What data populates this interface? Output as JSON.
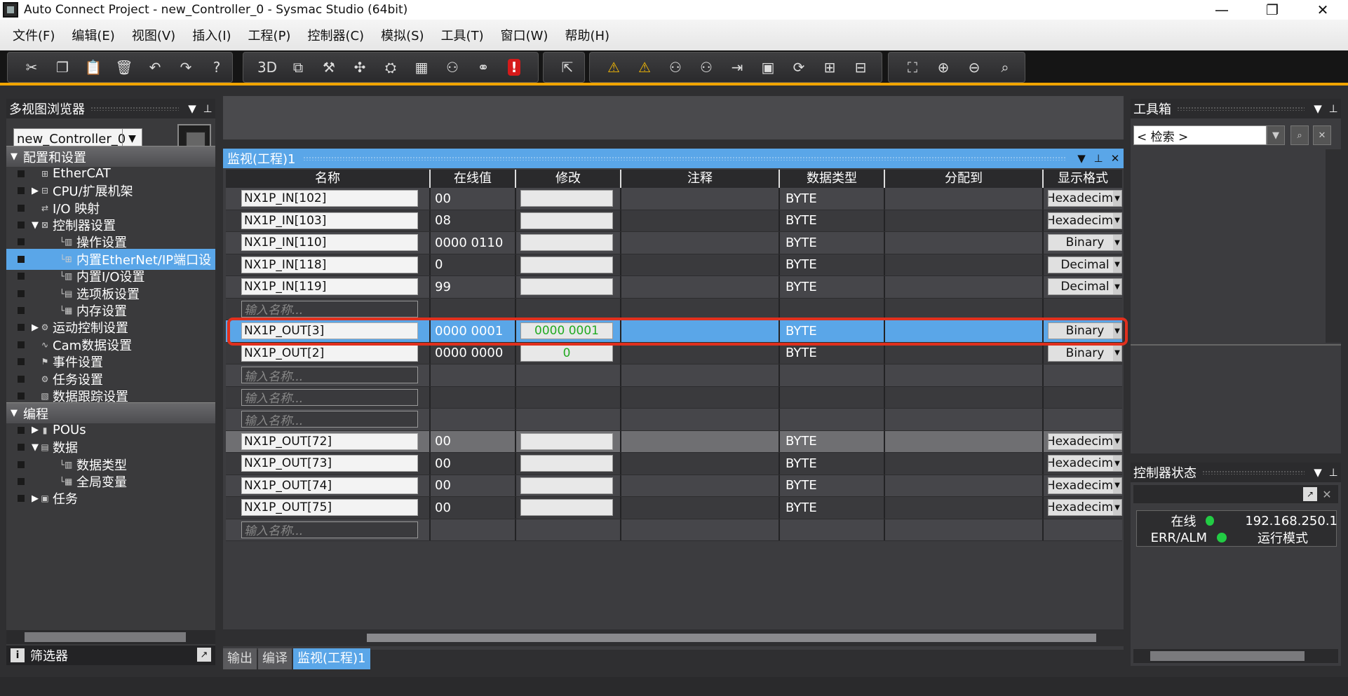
{
  "window": {
    "title": "Auto Connect Project - new_Controller_0 - Sysmac Studio (64bit)",
    "minimize": "—",
    "restore": "❐",
    "close": "✕"
  },
  "menu": [
    "文件(F)",
    "编辑(E)",
    "视图(V)",
    "插入(I)",
    "工程(P)",
    "控制器(C)",
    "模拟(S)",
    "工具(T)",
    "窗口(W)",
    "帮助(H)"
  ],
  "toolbar": {
    "group1": [
      {
        "name": "cut-icon",
        "glyph": "✂"
      },
      {
        "name": "copy-icon",
        "glyph": "❐"
      },
      {
        "name": "paste-icon",
        "glyph": "📋"
      },
      {
        "name": "delete-icon",
        "glyph": "🗑"
      },
      {
        "name": "undo-icon",
        "glyph": "↶"
      },
      {
        "name": "redo-icon",
        "glyph": "↷"
      },
      {
        "name": "help-icon",
        "glyph": "?"
      }
    ],
    "group2": [
      {
        "name": "3d-view-icon",
        "glyph": "3D"
      },
      {
        "name": "windows-icon",
        "glyph": "⧉"
      },
      {
        "name": "build-icon",
        "glyph": "⚒"
      },
      {
        "name": "tool-icon",
        "glyph": "✣"
      },
      {
        "name": "online-icon",
        "glyph": "⛭"
      },
      {
        "name": "table-icon",
        "glyph": "▦"
      },
      {
        "name": "io-icon",
        "glyph": "⚇"
      },
      {
        "name": "binoculars-icon",
        "glyph": "⚭"
      },
      {
        "name": "error-icon",
        "glyph": "!"
      }
    ],
    "group3": [
      {
        "name": "check-icon",
        "glyph": "⇱"
      }
    ],
    "group4": [
      {
        "name": "warning-icon",
        "glyph": "⚠"
      },
      {
        "name": "warning-off-icon",
        "glyph": "⚠"
      },
      {
        "name": "glasses-icon",
        "glyph": "⚇"
      },
      {
        "name": "glasses-stop-icon",
        "glyph": "⚇"
      },
      {
        "name": "step-icon",
        "glyph": "⇥"
      },
      {
        "name": "blocks-icon",
        "glyph": "▣"
      },
      {
        "name": "refresh-icon",
        "glyph": "⟳"
      },
      {
        "name": "network-icon",
        "glyph": "⊞"
      },
      {
        "name": "network2-icon",
        "glyph": "⊟"
      }
    ],
    "group5": [
      {
        "name": "fit-icon",
        "glyph": "⛶"
      },
      {
        "name": "zoom-in-icon",
        "glyph": "⊕"
      },
      {
        "name": "zoom-out-icon",
        "glyph": "⊖"
      },
      {
        "name": "zoom-reset-icon",
        "glyph": "⌕"
      }
    ]
  },
  "left_panel": {
    "title": "多视图浏览器",
    "controller": "new_Controller_0",
    "tree": [
      {
        "label": "配置和设置",
        "type": "section",
        "arrow": "▼"
      },
      {
        "label": "EtherCAT",
        "indent": 0,
        "arrow": "",
        "icon": "⊞"
      },
      {
        "label": "CPU/扩展机架",
        "indent": 0,
        "arrow": "▶",
        "icon": "⊟"
      },
      {
        "label": "I/O 映射",
        "indent": 0,
        "arrow": "",
        "icon": "⇄"
      },
      {
        "label": "控制器设置",
        "indent": 0,
        "arrow": "▼",
        "icon": "⊠"
      },
      {
        "label": "操作设置",
        "indent": 1,
        "arrow": "",
        "icon": "▥"
      },
      {
        "label": "内置EtherNet/IP端口设",
        "indent": 1,
        "arrow": "",
        "icon": "⊞",
        "selected": true
      },
      {
        "label": "内置I/O设置",
        "indent": 1,
        "arrow": "",
        "icon": "▥"
      },
      {
        "label": "选项板设置",
        "indent": 1,
        "arrow": "",
        "icon": "▤"
      },
      {
        "label": "内存设置",
        "indent": 1,
        "arrow": "",
        "icon": "▦"
      },
      {
        "label": "运动控制设置",
        "indent": 0,
        "arrow": "▶",
        "icon": "⚙"
      },
      {
        "label": "Cam数据设置",
        "indent": 0,
        "arrow": "",
        "icon": "∿"
      },
      {
        "label": "事件设置",
        "indent": 0,
        "arrow": "",
        "icon": "⚑"
      },
      {
        "label": "任务设置",
        "indent": 0,
        "arrow": "",
        "icon": "⚙"
      },
      {
        "label": "数据跟踪设置",
        "indent": 0,
        "arrow": "",
        "icon": "▧"
      },
      {
        "label": "编程",
        "type": "section",
        "arrow": "▼"
      },
      {
        "label": "POUs",
        "indent": 0,
        "arrow": "▶",
        "icon": "▮"
      },
      {
        "label": "数据",
        "indent": 0,
        "arrow": "▼",
        "icon": "▤"
      },
      {
        "label": "数据类型",
        "indent": 1,
        "arrow": "",
        "icon": "▥"
      },
      {
        "label": "全局变量",
        "indent": 1,
        "arrow": "",
        "icon": "▦"
      },
      {
        "label": "任务",
        "indent": 0,
        "arrow": "▶",
        "icon": "▣"
      }
    ],
    "filter_label": "筛选器"
  },
  "watch": {
    "title": "监视(工程)1",
    "columns": [
      "名称",
      "在线值",
      "修改",
      "注释",
      "数据类型",
      "分配到",
      "显示格式"
    ],
    "placeholder": "输入名称...",
    "rows": [
      {
        "name": "NX1P_IN[102]",
        "online": "00",
        "modify": "",
        "type": "BYTE",
        "format": "Hexadecimal",
        "style": "alt"
      },
      {
        "name": "NX1P_IN[103]",
        "online": "08",
        "modify": "",
        "type": "BYTE",
        "format": "Hexadecimal",
        "style": "norm"
      },
      {
        "name": "NX1P_IN[110]",
        "online": "0000 0110",
        "modify": "",
        "type": "BYTE",
        "format": "Binary",
        "style": "alt"
      },
      {
        "name": "NX1P_IN[118]",
        "online": "0",
        "modify": "",
        "type": "BYTE",
        "format": "Decimal",
        "style": "norm"
      },
      {
        "name": "NX1P_IN[119]",
        "online": "99",
        "modify": "",
        "type": "BYTE",
        "format": "Decimal",
        "style": "alt"
      },
      {
        "name": "",
        "online": "",
        "modify": "",
        "type": "",
        "format": "",
        "style": "norm",
        "empty": true
      },
      {
        "name": "NX1P_OUT[3]",
        "online": "0000 0001",
        "modify": "0000 0001",
        "type": "BYTE",
        "format": "Binary",
        "style": "hl"
      },
      {
        "name": "NX1P_OUT[2]",
        "online": "0000 0000",
        "modify": "0",
        "type": "BYTE",
        "format": "Binary",
        "style": "norm"
      },
      {
        "name": "",
        "online": "",
        "modify": "",
        "type": "",
        "format": "",
        "style": "alt",
        "empty": true
      },
      {
        "name": "",
        "online": "",
        "modify": "",
        "type": "",
        "format": "",
        "style": "norm",
        "empty": true
      },
      {
        "name": "",
        "online": "",
        "modify": "",
        "type": "",
        "format": "",
        "style": "alt",
        "empty": true
      },
      {
        "name": "NX1P_OUT[72]",
        "online": "00",
        "modify": "",
        "type": "BYTE",
        "format": "Hexadecimal",
        "style": "grey"
      },
      {
        "name": "NX1P_OUT[73]",
        "online": "00",
        "modify": "",
        "type": "BYTE",
        "format": "Hexadecimal",
        "style": "norm"
      },
      {
        "name": "NX1P_OUT[74]",
        "online": "00",
        "modify": "",
        "type": "BYTE",
        "format": "Hexadecimal",
        "style": "alt"
      },
      {
        "name": "NX1P_OUT[75]",
        "online": "00",
        "modify": "",
        "type": "BYTE",
        "format": "Hexadecimal",
        "style": "norm"
      },
      {
        "name": "",
        "online": "",
        "modify": "",
        "type": "",
        "format": "",
        "style": "alt",
        "empty": true
      }
    ]
  },
  "bottom_tabs": [
    {
      "label": "输出",
      "active": false
    },
    {
      "label": "编译",
      "active": false
    },
    {
      "label": "监视(工程)1",
      "active": true
    }
  ],
  "toolbox": {
    "title": "工具箱",
    "search_placeholder": "< 检索 >"
  },
  "controller_status": {
    "title": "控制器状态",
    "rows": [
      {
        "label": "在线",
        "value": "192.168.250.1",
        "color": "#22cc44"
      },
      {
        "label": "ERR/ALM",
        "value": "运行模式",
        "color": "#22cc44"
      }
    ]
  },
  "colors": {
    "accent": "#5aa6e8",
    "toolbar_underline": "#f0a400",
    "highlight_outline": "#e0301e",
    "status_ok": "#22cc44",
    "modify_text": "#22aa22"
  }
}
